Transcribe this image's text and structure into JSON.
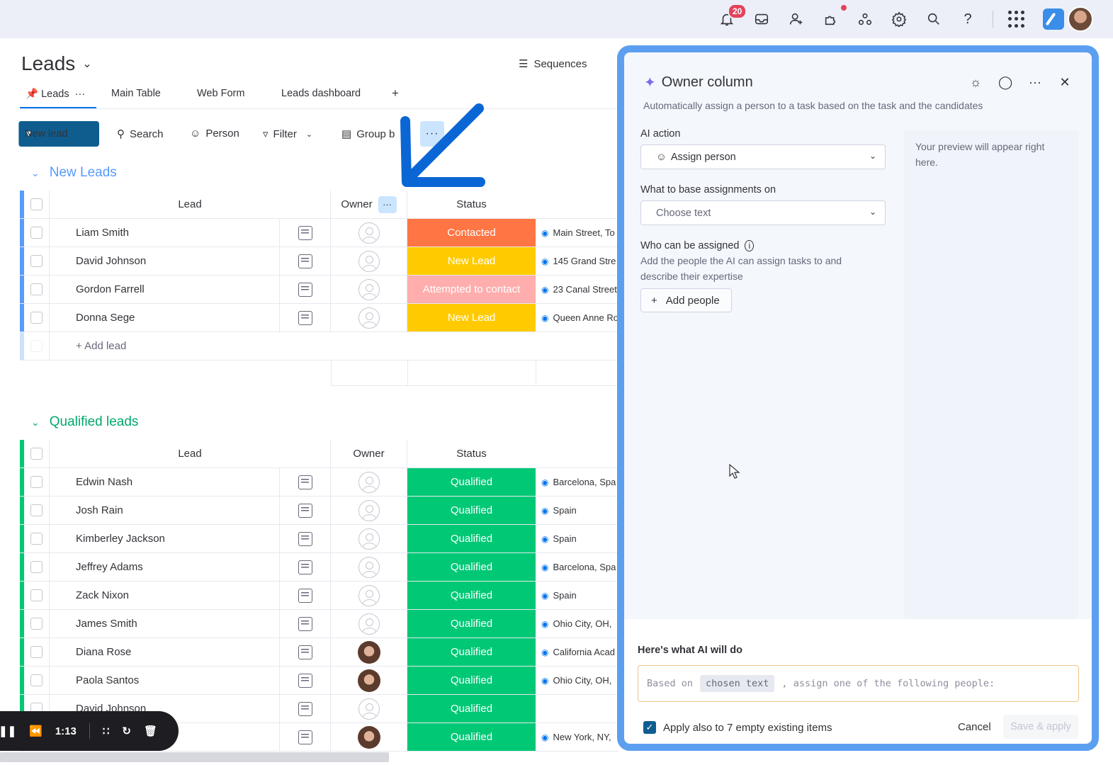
{
  "topbar": {
    "notification_count": "20"
  },
  "board": {
    "title": "Leads",
    "sequences_label": "Sequences",
    "tabs": [
      "Leads",
      "Main Table",
      "Web Form",
      "Leads dashboard"
    ],
    "add_tab": "+"
  },
  "toolbar": {
    "new_lead": "New lead",
    "search": "Search",
    "person": "Person",
    "filter": "Filter",
    "group_by": "Group b"
  },
  "columns": {
    "lead": "Lead",
    "owner": "Owner",
    "status": "Status"
  },
  "group_new": {
    "title": "New Leads",
    "color": "#579bfc",
    "rows": [
      {
        "name": "Liam Smith",
        "status": "Contacted",
        "status_color": "#ff7544",
        "location": "Main Street, To"
      },
      {
        "name": "David Johnson",
        "status": "New Lead",
        "status_color": "#ffcb00",
        "location": "145 Grand Stre"
      },
      {
        "name": "Gordon Farrell",
        "status": "Attempted to contact",
        "status_color": "#ffadad",
        "location": "23 Canal Street"
      },
      {
        "name": "Donna Sege",
        "status": "New Lead",
        "status_color": "#ffcb00",
        "location": "Queen Anne Ro"
      }
    ],
    "add_label": "+ Add lead"
  },
  "group_qualified": {
    "title": "Qualified leads",
    "color": "#00c875",
    "rows": [
      {
        "name": "Edwin Nash",
        "status": "Qualified",
        "location": "Barcelona, Spa",
        "photo": false
      },
      {
        "name": "Josh Rain",
        "status": "Qualified",
        "location": "Spain",
        "photo": false
      },
      {
        "name": "Kimberley Jackson",
        "status": "Qualified",
        "location": "Spain",
        "photo": false
      },
      {
        "name": "Jeffrey Adams",
        "status": "Qualified",
        "location": "Barcelona, Spa",
        "photo": false
      },
      {
        "name": "Zack Nixon",
        "status": "Qualified",
        "location": "Spain",
        "photo": false
      },
      {
        "name": "James Smith",
        "status": "Qualified",
        "location": "Ohio City, OH,",
        "photo": false
      },
      {
        "name": "Diana Rose",
        "status": "Qualified",
        "location": "California Acad",
        "photo": true
      },
      {
        "name": "Paola Santos",
        "status": "Qualified",
        "location": "Ohio City, OH,",
        "photo": true
      },
      {
        "name": "David Johnson",
        "status": "Qualified",
        "location": "",
        "photo": false
      },
      {
        "name": "",
        "status": "Qualified",
        "location": "New York, NY,",
        "photo": true
      }
    ]
  },
  "panel": {
    "title": "Owner column",
    "subtitle": "Automatically assign a person to a task based on the task and the candidates",
    "ai_action_label": "AI action",
    "ai_action_value": "Assign person",
    "base_label": "What to base assignments on",
    "base_placeholder": "Choose text",
    "who_label": "Who can be assigned",
    "who_desc": "Add the people the AI can assign tasks to and describe their expertise",
    "add_people": "Add people",
    "preview_text": "Your preview will appear right here.",
    "will_do_label": "Here's what AI will do",
    "prompt_pre": "Based on",
    "prompt_chip": "chosen text",
    "prompt_post": ", assign one of the following people:",
    "apply_label": "Apply also to 7 empty existing items",
    "cancel": "Cancel",
    "save": "Save & apply"
  },
  "player": {
    "time": "1:13"
  }
}
